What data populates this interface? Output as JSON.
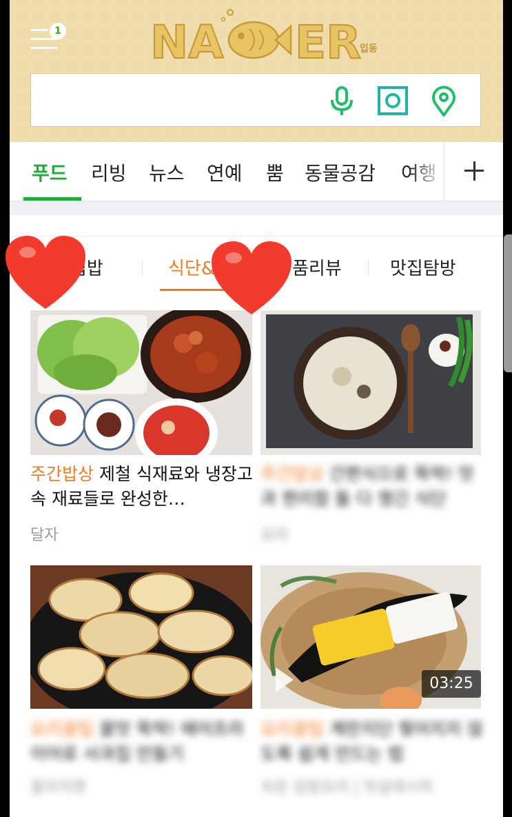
{
  "header": {
    "menu_badge": "1",
    "logo_text": "NAVER",
    "logo_sub": "입동",
    "search_placeholder": "",
    "search_value": ""
  },
  "tabs": [
    {
      "label": "푸드",
      "active": true
    },
    {
      "label": "리빙"
    },
    {
      "label": "뉴스"
    },
    {
      "label": "연예"
    },
    {
      "label": "뿜"
    },
    {
      "label": "동물공감"
    },
    {
      "label": "여행"
    }
  ],
  "subtabs": [
    {
      "label": "집밥"
    },
    {
      "label": "식단&",
      "active": true
    },
    {
      "label": "품리뷰"
    },
    {
      "label": "맛집탐방"
    }
  ],
  "articles": [
    {
      "category": "주간밥상",
      "title": "제철 식재료와 냉장고 속 재료들로 완성한…",
      "author": "달자"
    },
    {
      "category": "주간밥상",
      "title": "간편식으로 뚝딱! 맛과 편리함 둘 다 챙긴 식단",
      "author": "요리"
    },
    {
      "category": "요리꿀팁",
      "title": "꿀맛 뚝딱! 에어프라이어로 사과칩 만들기",
      "author": "꿀자지맨"
    },
    {
      "category": "요리꿀팁",
      "title": "계란지단 찢어지지 않도록 쉽게 만드는 법",
      "author": "쉬운 집밥요리 | 맛살레시피",
      "video_duration": "03:25"
    }
  ],
  "colors": {
    "naver_green": "#1faa3a",
    "accent_orange": "#ef7b23",
    "header_bg": "#efdcaa",
    "heart_red": "#f23b2c"
  }
}
